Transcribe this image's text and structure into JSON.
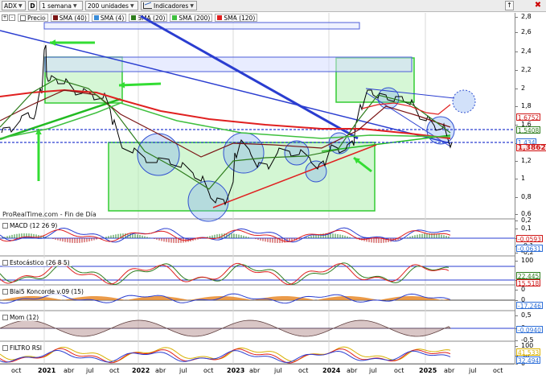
{
  "toolbar": {
    "symbol": "ADX",
    "mode_letter": "D",
    "period": "1 semana",
    "units": "200 unidades",
    "indicators_label": "Indicadores",
    "close_glyph": "✖",
    "up_glyph": "↑"
  },
  "legend": {
    "tool_plus": "+",
    "tool_minus": "-",
    "price_label": "Precio",
    "items": [
      {
        "label": "SMA (40)",
        "color": "#7b1515"
      },
      {
        "label": "SMA (4)",
        "color": "#3a8cd8"
      },
      {
        "label": "SMA (20)",
        "color": "#2e7d1d"
      },
      {
        "label": "SMA (200)",
        "color": "#3fc03f"
      },
      {
        "label": "SMA (120)",
        "color": "#e02020"
      }
    ]
  },
  "source_label": "ProRealTime.com - Fin de Día",
  "main_axis": {
    "ticks": [
      "2,8",
      "2,6",
      "2,4",
      "2,2",
      "2",
      "1,8",
      "1,6",
      "1,4",
      "1,2",
      "1",
      "0,8",
      "0,6"
    ],
    "badges": [
      {
        "text": "1,6752",
        "color": "#d01818"
      },
      {
        "text": "1,5408",
        "color": "#2e7d1d"
      },
      {
        "text": "1,434",
        "color": "#2e6fd8"
      },
      {
        "text": "1,3862",
        "color": "#d01818"
      }
    ]
  },
  "panels": [
    {
      "id": "macd",
      "title": "MACD (12 26 9)",
      "ticks": [
        "0,2",
        "0,1",
        "0",
        "-0,1",
        "-0,2"
      ],
      "badges": [
        {
          "text": "-0,0593",
          "color": "#d01818"
        },
        {
          "text": "-0,0631",
          "color": "#2e6fd8"
        }
      ]
    },
    {
      "id": "stoch",
      "title": "Estocástico (26 8 5)",
      "ticks": [
        "100",
        "50",
        "0"
      ],
      "badges": [
        {
          "text": "22,445",
          "color": "#2e7d1d"
        },
        {
          "text": "15,518",
          "color": "#d01818"
        }
      ]
    },
    {
      "id": "blai5",
      "title": "Blai5 Koncorde v.09 (15)",
      "ticks": [
        "0"
      ],
      "badges": [
        {
          "text": "-17,246",
          "color": "#2e6fd8"
        }
      ]
    },
    {
      "id": "mom",
      "title": "Mom (12)",
      "ticks": [
        "0,5",
        "0",
        "-0,5"
      ],
      "badges": [
        {
          "text": "-0,0940",
          "color": "#2e6fd8"
        }
      ]
    },
    {
      "id": "rsi",
      "title": "FILTRO RSI",
      "ticks": [
        "100",
        "50",
        "0"
      ],
      "badges": [
        {
          "text": "41,533",
          "color": "#d8b000"
        },
        {
          "text": "32,494",
          "color": "#2e6fd8"
        }
      ]
    }
  ],
  "x_axis": [
    {
      "label": "oct",
      "year": false
    },
    {
      "label": "2021",
      "year": true
    },
    {
      "label": "abr",
      "year": false
    },
    {
      "label": "jul",
      "year": false
    },
    {
      "label": "oct",
      "year": false
    },
    {
      "label": "2022",
      "year": true
    },
    {
      "label": "abr",
      "year": false
    },
    {
      "label": "jul",
      "year": false
    },
    {
      "label": "oct",
      "year": false
    },
    {
      "label": "2023",
      "year": true
    },
    {
      "label": "abr",
      "year": false
    },
    {
      "label": "jul",
      "year": false
    },
    {
      "label": "oct",
      "year": false
    },
    {
      "label": "2024",
      "year": true
    },
    {
      "label": "abr",
      "year": false
    },
    {
      "label": "jul",
      "year": false
    },
    {
      "label": "oct",
      "year": false
    },
    {
      "label": "2025",
      "year": true
    },
    {
      "label": "abr",
      "year": false
    },
    {
      "label": "jul",
      "year": false
    },
    {
      "label": "oct",
      "year": false
    }
  ]
}
